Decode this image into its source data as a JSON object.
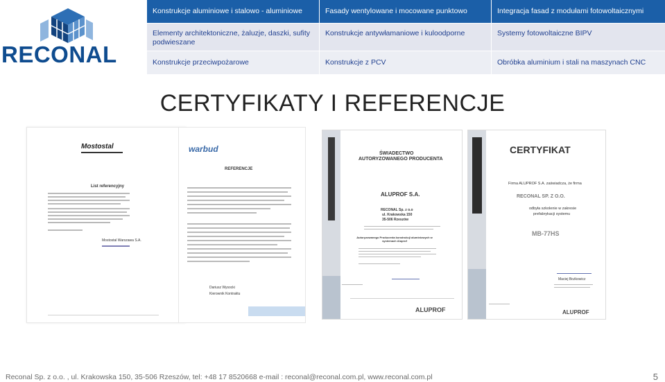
{
  "brand": {
    "name": "RECONAL",
    "accent": "#1b5fa8",
    "dark_blue": "#0f4c8f"
  },
  "nav": {
    "rows": [
      [
        "Konstrukcje aluminiowe i stalowo - aluminiowe",
        "Fasady wentylowane i mocowane punktowo",
        "Integracja fasad z modułami fotowoltaicznymi"
      ],
      [
        "Elementy architektoniczne, żaluzje, daszki, sufity podwieszane",
        "Konstrukcje antywłamaniowe i kuloodporne",
        "Systemy fotowoltaiczne BIPV"
      ],
      [
        "Konstrukcje przeciwpożarowe",
        "Konstrukcje z PCV",
        "Obróbka aluminium i stali na maszynach CNC"
      ]
    ]
  },
  "title": "CERTYFIKATY I REFERENCJE",
  "certificates": {
    "mostostal": {
      "logo": "Mostostal",
      "heading": "List referencyjny",
      "footer_sign": "Mostostal Warszawa S.A."
    },
    "warbud": {
      "logo": "warbud",
      "heading": "REFERENCJE",
      "sign": "Dariusz Wysocki",
      "sign_role": "Kierownik Kontraktu"
    },
    "aluprof_authorized": {
      "heading1": "ŚWIADECTWO",
      "heading2": "AUTORYZOWANEGO PRODUCENTA",
      "company": "ALUPROF S.A.",
      "holder": "RECONAL Sp. z o.o",
      "address1": "ul. Krakowska 150",
      "address2": "35-506 Rzeszów",
      "role": "Autoryzowanego Producenta konstrukcji aluminiowych w systemach Aluprof",
      "footer_logo": "ALUPROF"
    },
    "aluprof_certificate": {
      "heading": "CERTYFIKAT",
      "intro": "Firma ALUPROF S.A. zaświadcza, że firma",
      "holder": "RECONAL SP. Z O.O.",
      "text1": "odbyła szkolenie w zakresie",
      "text2": "prefabrykacji systemu",
      "system": "MB-77HS",
      "signer": "Maciej Bożkowicz",
      "footer_logo": "ALUPROF"
    }
  },
  "footer": "Reconal Sp. z o.o. , ul. Krakowska 150, 35-506 Rzeszów, tel: +48 17 8520668  e-mail : reconal@reconal.com.pl,  www.reconal.com.pl",
  "page_number": "5"
}
